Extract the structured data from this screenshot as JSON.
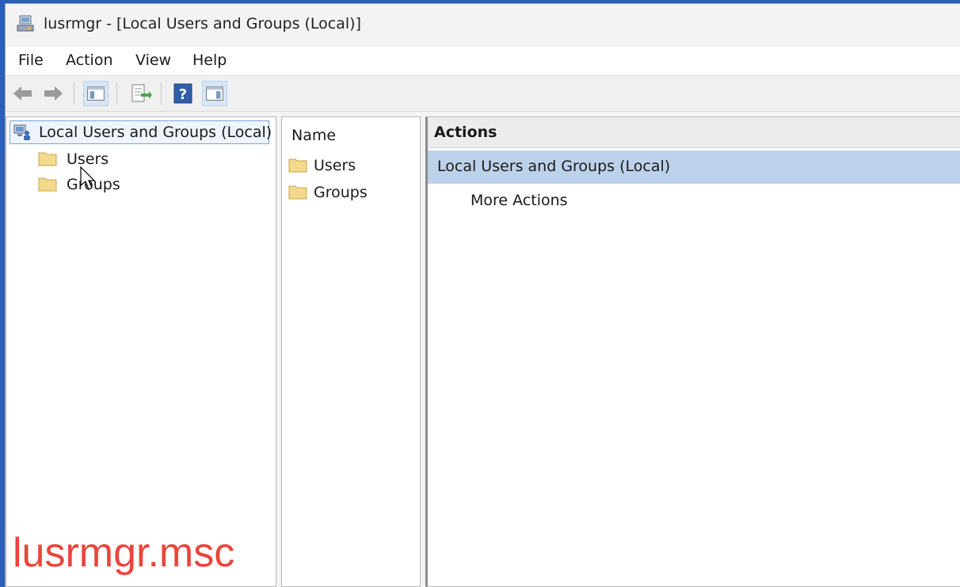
{
  "window": {
    "title": "lusrmgr - [Local Users and Groups (Local)]"
  },
  "menu": {
    "items": [
      "File",
      "Action",
      "View",
      "Help"
    ]
  },
  "toolbar": {
    "buttons": [
      "back-icon",
      "forward-icon",
      "show-hide-tree-icon",
      "export-list-icon",
      "help-icon",
      "show-hide-action-pane-icon"
    ]
  },
  "tree": {
    "root_label": "Local Users and Groups (Local)",
    "children": [
      "Users",
      "Groups"
    ]
  },
  "list": {
    "header": "Name",
    "items": [
      "Users",
      "Groups"
    ]
  },
  "actions": {
    "title": "Actions",
    "section": "Local Users and Groups (Local)",
    "more": "More Actions"
  },
  "overlay": {
    "caption": "lusrmgr.msc"
  },
  "colors": {
    "desktop": "#2b5fb8",
    "selection": "#bcd2ea",
    "caption": "#e8453c"
  }
}
